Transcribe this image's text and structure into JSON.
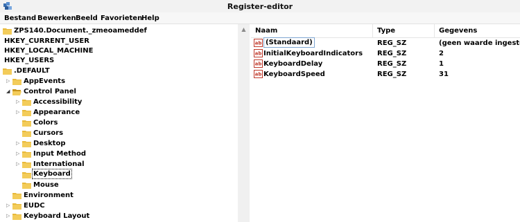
{
  "window": {
    "title": "Register-editor"
  },
  "menu": [
    {
      "label": "Bestand"
    },
    {
      "label": "Bewerken"
    },
    {
      "label": "Beeld"
    },
    {
      "label": "Favorieten"
    },
    {
      "label": "Help"
    }
  ],
  "tree": {
    "items": [
      {
        "label": "ZPS140.Document._zmeoameddef"
      },
      {
        "label": "HKEY_CURRENT_USER"
      },
      {
        "label": "HKEY_LOCAL_MACHINE"
      },
      {
        "label": "HKEY_USERS"
      },
      {
        "label": ".DEFAULT"
      },
      {
        "label": "AppEvents"
      },
      {
        "label": "Control Panel"
      },
      {
        "label": "Accessibility"
      },
      {
        "label": "Appearance"
      },
      {
        "label": "Colors"
      },
      {
        "label": "Cursors"
      },
      {
        "label": "Desktop"
      },
      {
        "label": "Input Method"
      },
      {
        "label": "International"
      },
      {
        "label": "Keyboard"
      },
      {
        "label": "Mouse"
      },
      {
        "label": "Environment"
      },
      {
        "label": "EUDC"
      },
      {
        "label": "Keyboard Layout"
      }
    ]
  },
  "list": {
    "columns": {
      "name": "Naam",
      "type": "Type",
      "data": "Gegevens"
    },
    "rows": [
      {
        "name": "(Standaard)",
        "type": "REG_SZ",
        "data": "(geen waarde ingesteld)"
      },
      {
        "name": "InitialKeyboardIndicators",
        "type": "REG_SZ",
        "data": "2"
      },
      {
        "name": "KeyboardDelay",
        "type": "REG_SZ",
        "data": "1"
      },
      {
        "name": "KeyboardSpeed",
        "type": "REG_SZ",
        "data": "31"
      }
    ]
  },
  "colors": {
    "folder": "#e8b93a",
    "folder_dark": "#c8951c",
    "ab_icon": "#c0392b"
  }
}
